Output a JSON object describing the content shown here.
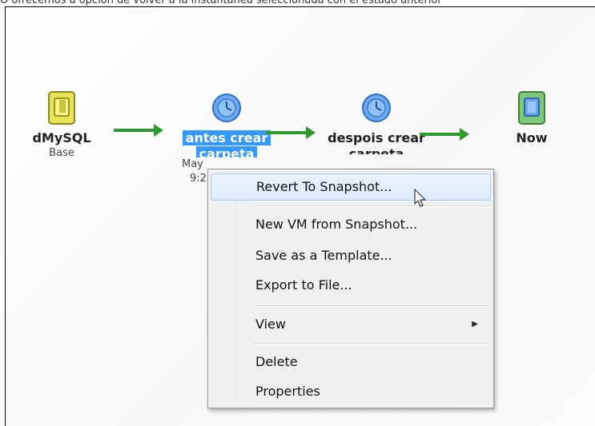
{
  "caption": {
    "text": "O ofrecemos a opción de volver a la instantánea seleccionada con el estado anterior"
  },
  "nodes": [
    {
      "name": "dMySQL",
      "sub": "Base"
    },
    {
      "name": "antes crear",
      "name2": "carpeta",
      "sub1": "May",
      "sub2": "9:2"
    },
    {
      "name": "despois crear",
      "name2": "carpeta"
    },
    {
      "name": "Now"
    }
  ],
  "menu": {
    "items": [
      {
        "label": "Revert To Snapshot..."
      },
      {
        "label": "New VM from Snapshot..."
      },
      {
        "label": "Save as a Template..."
      },
      {
        "label": "Export to File..."
      },
      {
        "label": "View"
      },
      {
        "label": "Delete"
      },
      {
        "label": "Properties"
      }
    ],
    "submenu_icon": "triangle-right-icon"
  },
  "colors": {
    "arrow": "#2d9a2d",
    "selection": "#3399ff"
  }
}
